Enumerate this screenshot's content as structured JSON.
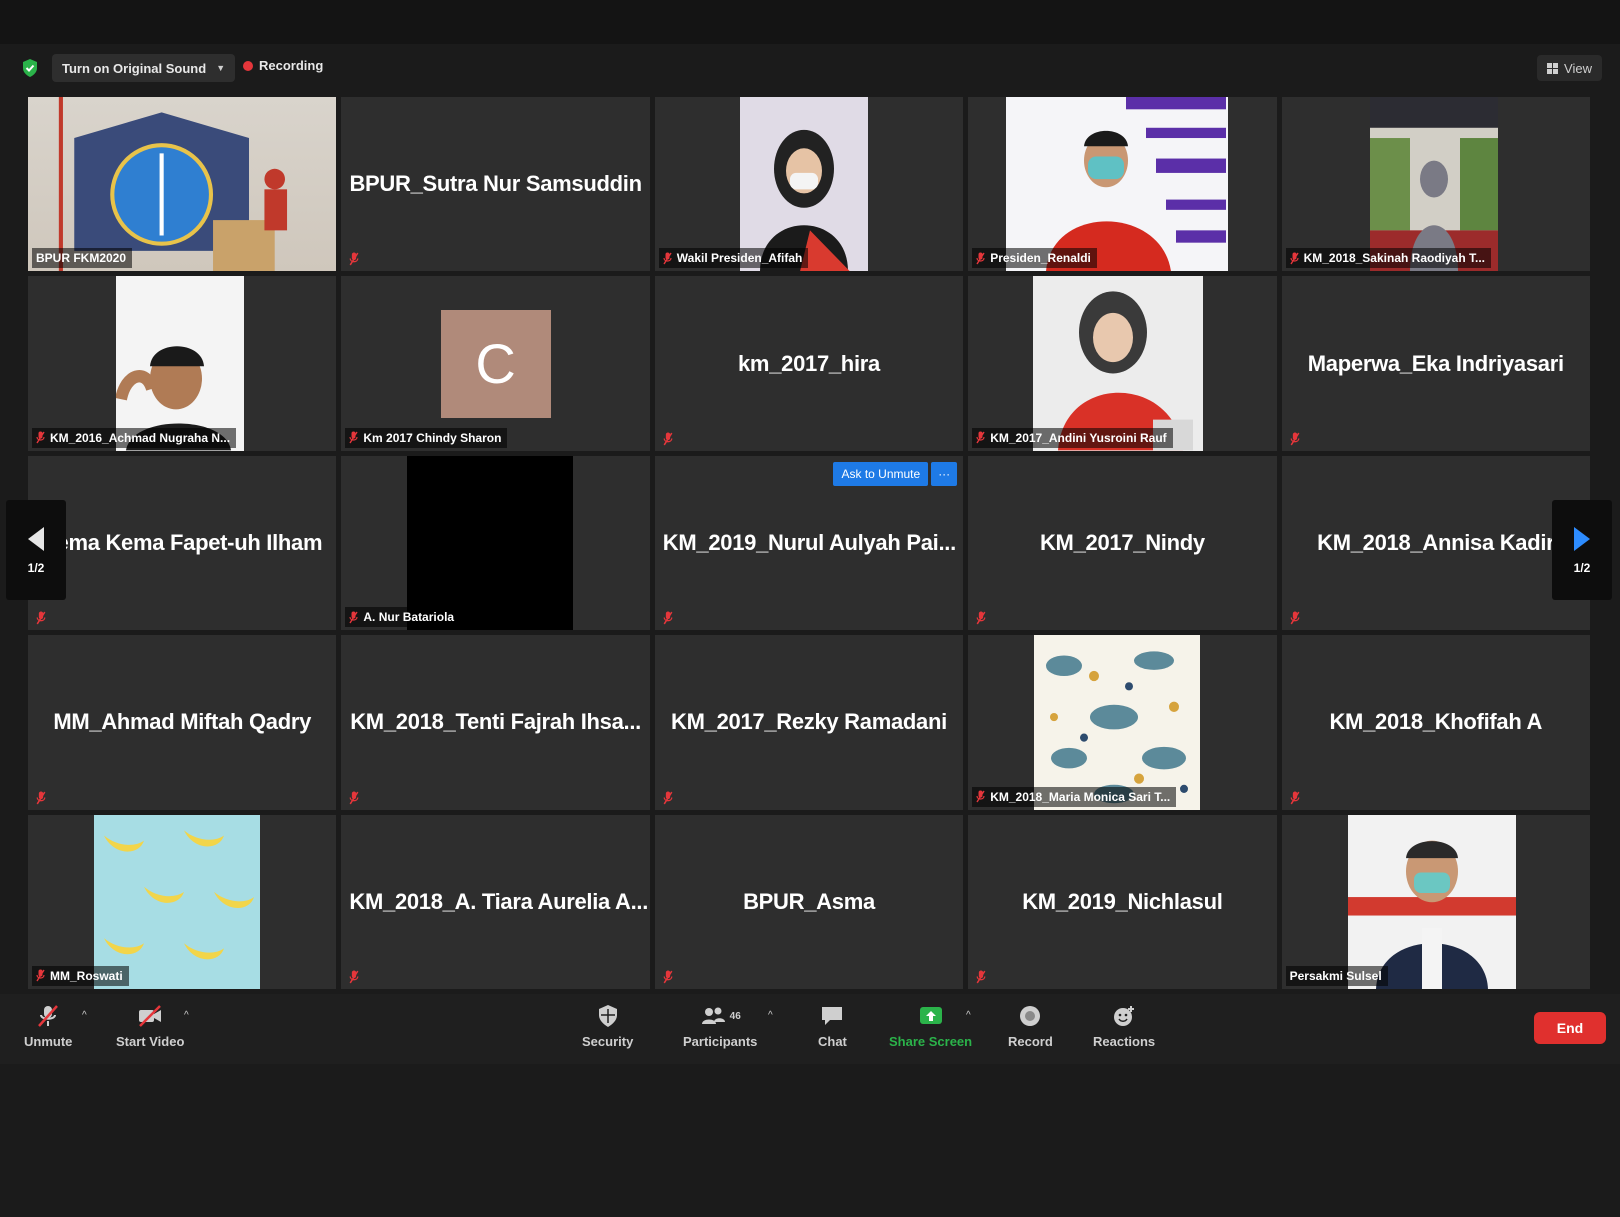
{
  "infobar": {
    "original_sound_label": "Turn on Original Sound",
    "recording_label": "Recording",
    "view_label": "View"
  },
  "pager": {
    "left_label": "1/2",
    "right_label": "1/2"
  },
  "tiles": [
    {
      "tag": "BPUR FKM2020",
      "big": "",
      "video": "seal"
    },
    {
      "tag": "",
      "big": "BPUR_Sutra Nur Samsuddin",
      "video": ""
    },
    {
      "tag": "Wakil Presiden_Afifah",
      "big": "",
      "video": "person-red"
    },
    {
      "tag": "Presiden_Renaldi",
      "big": "",
      "video": "person-purple"
    },
    {
      "tag": "KM_2018_Sakinah Raodiyah T...",
      "big": "",
      "video": "outdoor"
    },
    {
      "tag": "KM_2016_Achmad Nugraha N...",
      "big": "",
      "video": "person-white"
    },
    {
      "tag": "Km 2017 Chindy Sharon",
      "big": "",
      "video": "avatar-c"
    },
    {
      "tag": "",
      "big": "km_2017_hira",
      "video": ""
    },
    {
      "tag": "KM_2017_Andini Yusroini Rauf",
      "big": "",
      "video": "person-hijab"
    },
    {
      "tag": "",
      "big": "Maperwa_Eka Indriyasari",
      "video": ""
    },
    {
      "tag": "",
      "big": "Sema Kema Fapet-uh Ilham",
      "video": ""
    },
    {
      "tag": "A. Nur Batariola",
      "big": "",
      "video": "black"
    },
    {
      "tag": "",
      "big": "KM_2019_Nurul Aulyah Pai...",
      "video": ""
    },
    {
      "tag": "",
      "big": "KM_2017_Nindy",
      "video": ""
    },
    {
      "tag": "",
      "big": "KM_2018_Annisa Kadir",
      "video": ""
    },
    {
      "tag": "",
      "big": "MM_Ahmad Miftah Qadry",
      "video": ""
    },
    {
      "tag": "",
      "big": "KM_2018_Tenti Fajrah Ihsa...",
      "video": ""
    },
    {
      "tag": "",
      "big": "KM_2017_Rezky Ramadani",
      "video": ""
    },
    {
      "tag": "KM_2018_Maria Monica Sari T...",
      "big": "",
      "video": "floral"
    },
    {
      "tag": "",
      "big": "KM_2018_Khofifah A",
      "video": ""
    },
    {
      "tag": "MM_Roswati",
      "big": "",
      "video": "banana"
    },
    {
      "tag": "",
      "big": "KM_2018_A. Tiara Aurelia A...",
      "video": ""
    },
    {
      "tag": "",
      "big": "BPUR_Asma",
      "video": ""
    },
    {
      "tag": "",
      "big": "KM_2019_Nichlasul",
      "video": ""
    },
    {
      "tag": "Persakmi Sulsel",
      "big": "",
      "video": "person-vest"
    }
  ],
  "ask_unmute": {
    "label": "Ask to Unmute",
    "more": "···"
  },
  "toolbar": {
    "unmute": "Unmute",
    "start_video": "Start Video",
    "security": "Security",
    "participants": "Participants",
    "participant_count": "46",
    "chat": "Chat",
    "share_screen": "Share Screen",
    "record": "Record",
    "reactions": "Reactions",
    "end": "End"
  },
  "colors": {
    "active_speaker": "#c8e05a",
    "share_green": "#2bb34a",
    "end_red": "#e0302e",
    "accent_blue": "#1e7ae6"
  }
}
